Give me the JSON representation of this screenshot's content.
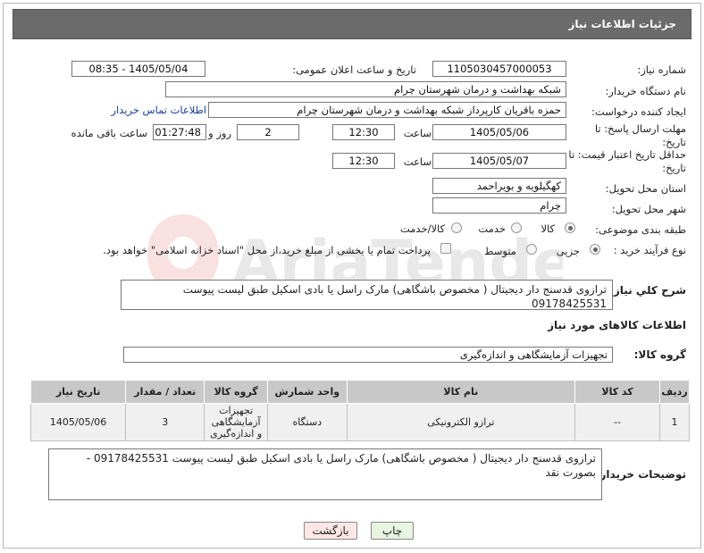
{
  "header": {
    "title": "جزئیات اطلاعات نیاز"
  },
  "fields": {
    "need_number_label": "شماره نیاز:",
    "need_number": "1105030457000053",
    "announce_label": "تاریخ و ساعت اعلان عمومی:",
    "announce_value": "1405/05/04 - 08:35",
    "buyer_org_label": "نام دستگاه خریدار:",
    "buyer_org": "شبکه بهداشت و درمان شهرستان چرام",
    "requester_label": "ایجاد کننده درخواست:",
    "requester": "حمزه باقریان کارپرداز شبکه بهداشت و درمان شهرستان چرام",
    "contact_link": "اطلاعات تماس خریدار",
    "deadline_label": "مهلت ارسال پاسخ: تا تاریخ:",
    "deadline_date": "1405/05/06",
    "time_label": "ساعت",
    "deadline_time": "12:30",
    "days_value": "2",
    "days_label": "روز و",
    "remaining_time": "01:27:48",
    "remaining_label": "ساعت باقی مانده",
    "validity_label": "حداقل تاریخ اعتبار قیمت: تا تاریخ:",
    "validity_date": "1405/05/07",
    "validity_time": "12:30",
    "province_label": "استان محل تحویل:",
    "province": "کهگیلویه و بویراحمد",
    "city_label": "شهر محل تحویل:",
    "city": "چرام",
    "category_label": "طبقه بندی موضوعی:",
    "category_options": [
      "کالا",
      "خدمت",
      "کالا/خدمت"
    ],
    "process_label": "نوع فرآیند خرید :",
    "process_options": [
      "جزیی",
      "متوسط"
    ],
    "payment_note": "پرداخت تمام یا بخشی از مبلغ خرید،از محل \"اسناد خزانه اسلامی\" خواهد بود."
  },
  "summary": {
    "label": "شرح کلي نياز:",
    "text": "ترازوی قدسنج دار دیجیتال ( مخصوص باشگاهی) مارک راسل یا بادی اسکیل طبق لیست پیوست 09178425531"
  },
  "goods_info": {
    "title": "اطلاعات کالاهای مورد نیاز",
    "group_label": "گروه کالا:",
    "group_value": "تجهیزات آزمایشگاهی و اندازه‌گیری"
  },
  "table": {
    "headers": [
      "ردیف",
      "کد کالا",
      "نام کالا",
      "واحد شمارش",
      "گروه کالا",
      "تعداد / مقدار",
      "تاریخ نیاز"
    ],
    "rows": [
      [
        "1",
        "--",
        "ترازو الکترونیکی",
        "دستگاه",
        "تجهیزات آزمایشگاهی و اندازه‌گیری",
        "3",
        "1405/05/06"
      ]
    ]
  },
  "buyer_notes": {
    "label": "توضیحات خریدار:",
    "text": "ترازوی قدسنج دار دیجیتال ( مخصوص باشگاهی) مارک راسل یا بادی اسکیل طبق لیست پیوست 09178425531 - بصورت نقد"
  },
  "buttons": {
    "print": "چاپ",
    "back": "بازگشت"
  },
  "watermark_text": "AriaTender.neT",
  "colors": {
    "header_bg": "#6b6b6b",
    "link": "#1a3d9c",
    "print_bg": "#e8f5e0",
    "back_bg": "#fde6e6"
  }
}
